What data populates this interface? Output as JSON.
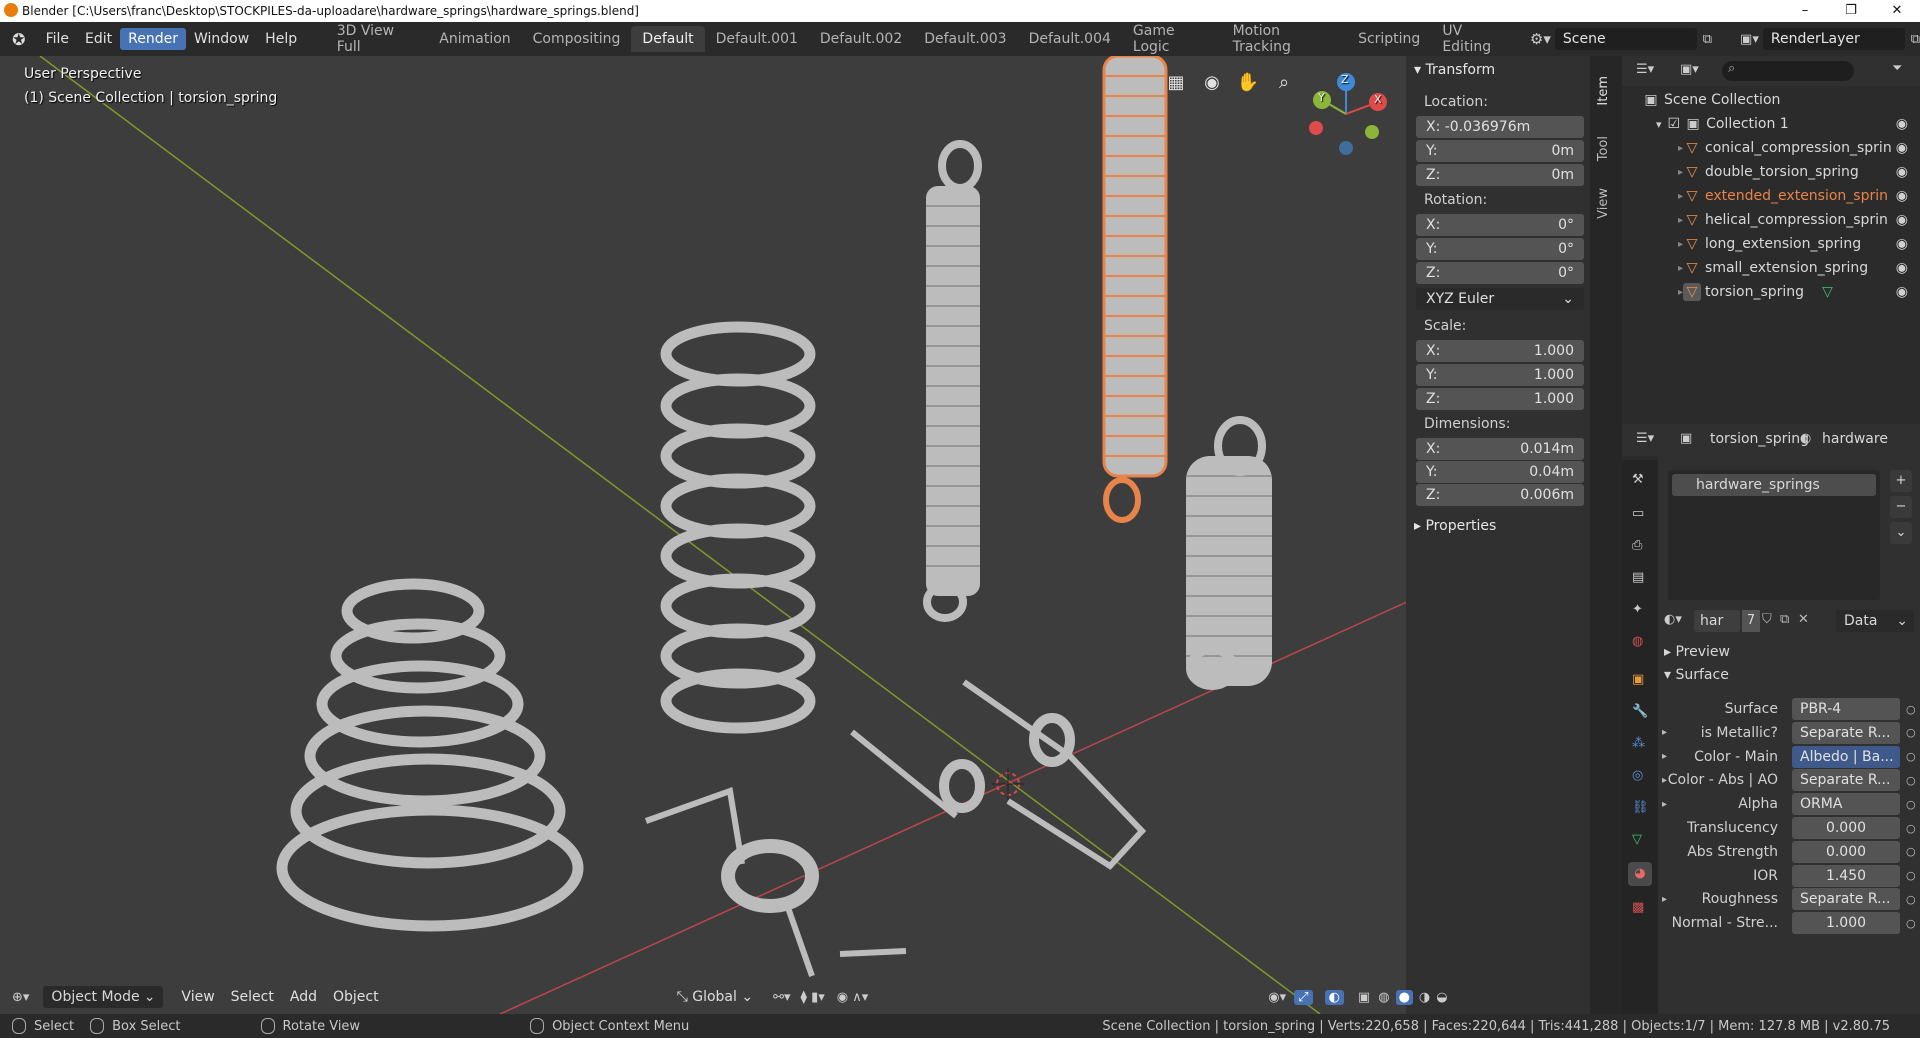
{
  "window": {
    "title": "Blender [C:\\Users\\franc\\Desktop\\STOCKPILES-da-uploadare\\hardware_springs\\hardware_springs.blend]",
    "controls": [
      "–",
      "❐",
      "✕"
    ]
  },
  "menu": [
    "File",
    "Edit",
    "Render",
    "Window",
    "Help"
  ],
  "menu_active": "Render",
  "workspaces": [
    "3D View Full",
    "Animation",
    "Compositing",
    "Default",
    "Default.001",
    "Default.002",
    "Default.003",
    "Default.004",
    "Game Logic",
    "Motion Tracking",
    "Scripting",
    "UV Editing"
  ],
  "workspace_active": "Default",
  "scene_name": "Scene",
  "view_layer": "RenderLayer",
  "viewport": {
    "perspective": "User Perspective",
    "collection_info": "(1) Scene Collection | torsion_spring",
    "gizmo_axes": [
      "X",
      "Y",
      "Z"
    ]
  },
  "side_tabs": [
    "Item",
    "Tool",
    "View"
  ],
  "transform": {
    "header": "Transform",
    "location_label": "Location:",
    "location": {
      "x": "X: -0.036976m",
      "y_label": "Y:",
      "y": "0m",
      "z_label": "Z:",
      "z": "0m"
    },
    "rotation_label": "Rotation:",
    "rotation": {
      "x_label": "X:",
      "x": "0°",
      "y_label": "Y:",
      "y": "0°",
      "z_label": "Z:",
      "z": "0°"
    },
    "rotation_mode": "XYZ Euler",
    "scale_label": "Scale:",
    "scale": {
      "x_label": "X:",
      "x": "1.000",
      "y_label": "Y:",
      "y": "1.000",
      "z_label": "Z:",
      "z": "1.000"
    },
    "dimensions_label": "Dimensions:",
    "dimensions": {
      "x_label": "X:",
      "x": "0.014m",
      "y_label": "Y:",
      "y": "0.04m",
      "z_label": "Z:",
      "z": "0.006m"
    },
    "properties_header": "Properties"
  },
  "outliner": {
    "root": "Scene Collection",
    "collection": "Collection 1",
    "items": [
      {
        "name": "conical_compression_sprin",
        "selected": false
      },
      {
        "name": "double_torsion_spring",
        "selected": false
      },
      {
        "name": "extended_extension_sprin",
        "selected": true
      },
      {
        "name": "helical_compression_sprin",
        "selected": false
      },
      {
        "name": "long_extension_spring",
        "selected": false
      },
      {
        "name": "small_extension_spring",
        "selected": false
      },
      {
        "name": "torsion_spring",
        "selected": false
      }
    ]
  },
  "properties": {
    "object_name": "torsion_spring",
    "material_tab": "hardware",
    "material_slot": "hardware_springs",
    "material_short": "har",
    "user_count": "7",
    "link": "Data",
    "preview_label": "Preview",
    "surface_label": "Surface",
    "rows": [
      {
        "label": "Surface",
        "value": "PBR-4",
        "expand": false
      },
      {
        "label": "is Metallic?",
        "value": "Separate R...",
        "expand": true
      },
      {
        "label": "Color - Main",
        "value": "Albedo | Ba...",
        "expand": true,
        "highlight": true
      },
      {
        "label": "Color - Abs | AO",
        "value": "Separate R...",
        "expand": true
      },
      {
        "label": "Alpha",
        "value": "ORMA",
        "expand": true
      },
      {
        "label": "Translucency",
        "value": "0.000",
        "expand": false,
        "numeric": true
      },
      {
        "label": "Abs Strength",
        "value": "0.000",
        "expand": false,
        "numeric": true
      },
      {
        "label": "IOR",
        "value": "1.450",
        "expand": false,
        "numeric": true
      },
      {
        "label": "Roughness",
        "value": "Separate R...",
        "expand": true
      },
      {
        "label": "Normal - Stre...",
        "value": "1.000",
        "expand": false,
        "numeric": true
      }
    ]
  },
  "viewport_header": {
    "mode": "Object Mode",
    "menus": [
      "View",
      "Select",
      "Add",
      "Object"
    ],
    "orientation": "Global"
  },
  "statusbar": {
    "select": "Select",
    "box_select": "Box Select",
    "rotate_view": "Rotate View",
    "context_menu": "Object Context Menu",
    "stats": "Scene Collection | torsion_spring | Verts:220,658 | Faces:220,644 | Tris:441,288 | Objects:1/7 | Mem: 127.8 MB | v2.80.75"
  },
  "colors": {
    "accent": "#4772b3",
    "selected_orange": "#e8834a",
    "spring_gray": "#bdbdbd",
    "viewport_bg": "#3d3d3d"
  }
}
